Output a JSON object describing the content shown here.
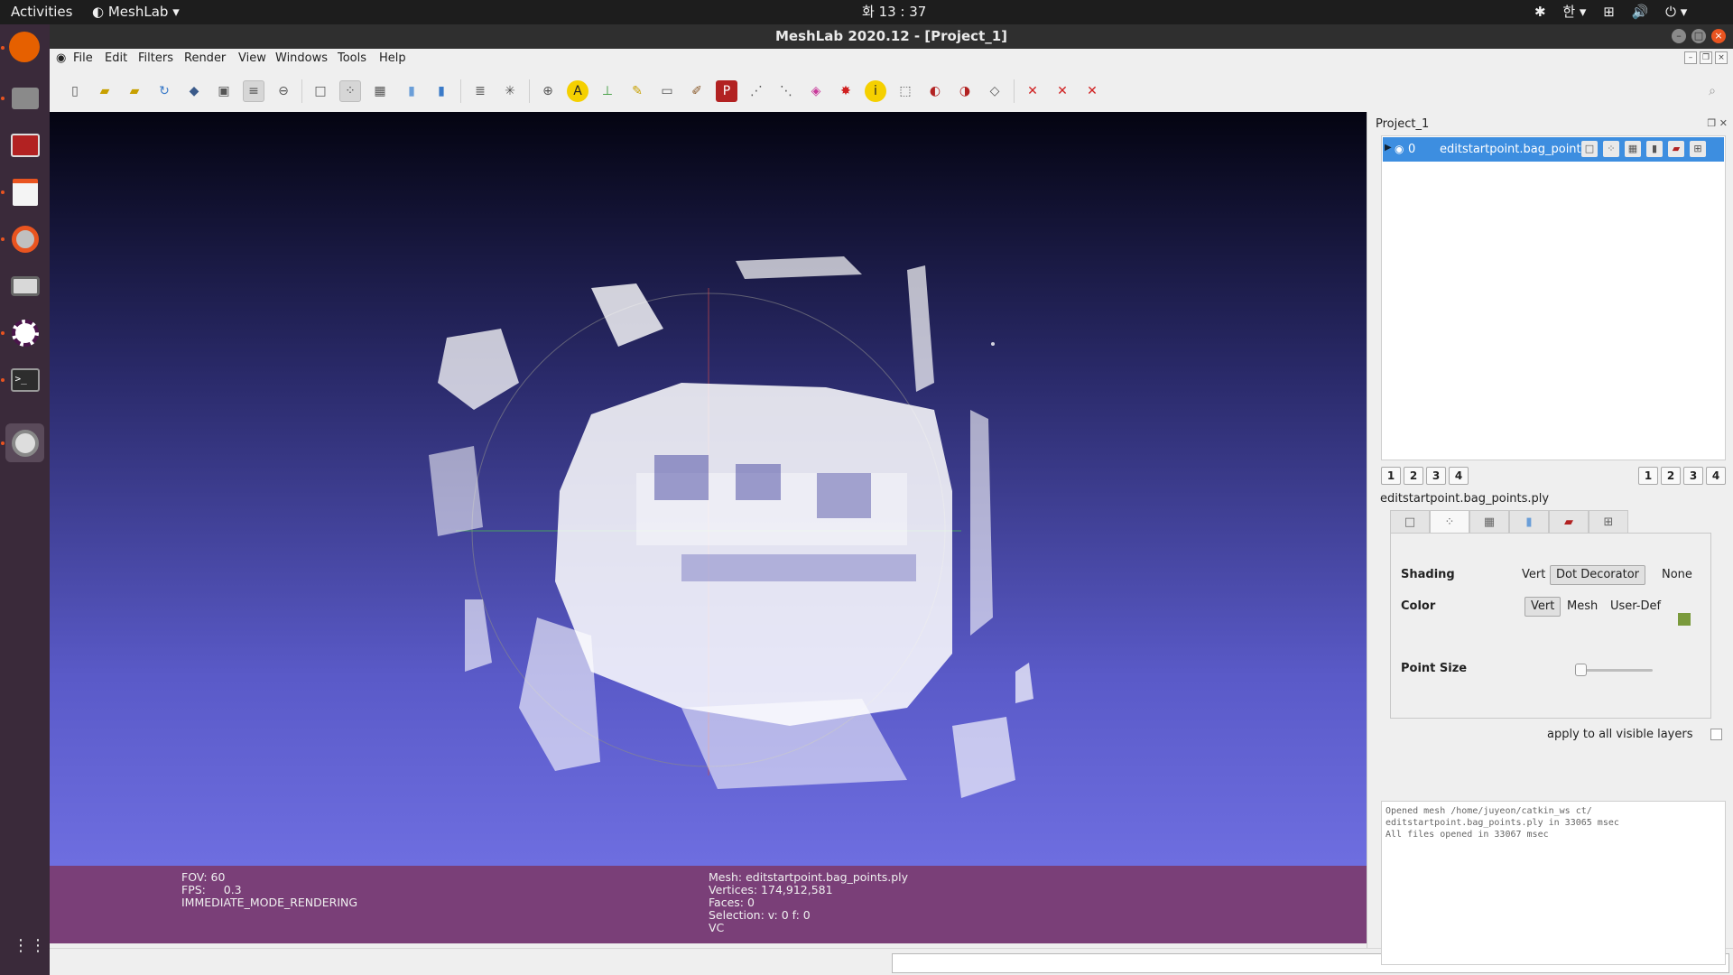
{
  "topbar": {
    "activities": "Activities",
    "app_menu": "MeshLab ▾",
    "clock": "화 13 : 37",
    "input_method": "한 ▾",
    "indicators": [
      "network-icon",
      "volume-icon",
      "power-icon"
    ]
  },
  "dock": {
    "items": [
      "firefox-icon",
      "files-icon",
      "terminal-red-icon",
      "text-editor-icon",
      "settings-icon",
      "camera-icon",
      "slack-icon",
      "terminal-icon",
      "meshlab-icon"
    ],
    "show_apps": "⋮⋮⋮"
  },
  "window": {
    "title": "MeshLab 2020.12 - [Project_1]"
  },
  "menubar": {
    "items": [
      "File",
      "Edit",
      "Filters",
      "Render",
      "View",
      "Windows",
      "Tools",
      "Help"
    ]
  },
  "viewport": {
    "background_top": "#040411",
    "background_bottom": "#6e6ee0"
  },
  "infobar": {
    "fov": "FOV: 60",
    "fps": "FPS:     0.3",
    "render_mode": "IMMEDIATE_MODE_RENDERING",
    "mesh": "Mesh: editstartpoint.bag_points.ply",
    "vertices": "Vertices: 174,912,581",
    "faces": "Faces: 0",
    "selection": "Selection: v: 0 f: 0",
    "vc": "VC"
  },
  "panel": {
    "project_title": "Project_1",
    "layer": {
      "index": "0",
      "name": "editstartpoint.bag_points"
    },
    "left_view_buttons": [
      "1",
      "2",
      "3",
      "4"
    ],
    "right_view_buttons": [
      "1",
      "2",
      "3",
      "4"
    ],
    "mesh_file": "editstartpoint.bag_points.ply",
    "shading": {
      "label": "Shading",
      "options": [
        "Vert",
        "Dot Decorator",
        "None"
      ],
      "selected": "Dot Decorator"
    },
    "color": {
      "label": "Color",
      "options": [
        "Vert",
        "Mesh",
        "User-Def"
      ],
      "selected": "Vert",
      "user_def_color": "#7a9a3c"
    },
    "point_size": {
      "label": "Point Size",
      "value_fraction": 0.0
    },
    "apply_all": "apply to all visible layers",
    "log": [
      "Opened mesh /home/juyeon/catkin_ws ct/",
      "editstartpoint.bag_points.ply in 33065 msec",
      "All files opened in 33067 msec"
    ]
  },
  "accent": {
    "selection_blue": "#3d8ee0",
    "infobar_purple": "#7a3f78",
    "ubuntu_orange": "#e95420"
  }
}
